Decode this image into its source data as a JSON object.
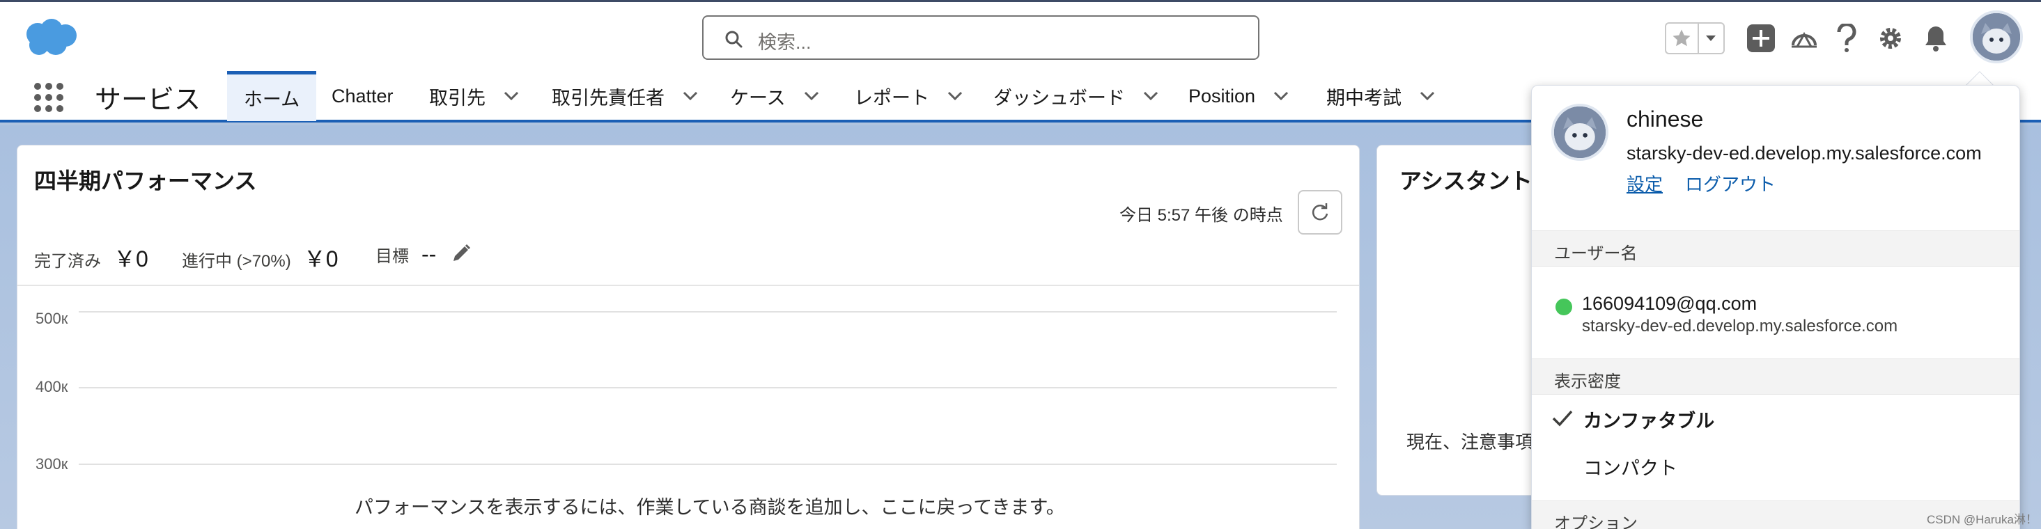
{
  "header": {
    "search_placeholder": "検索...",
    "icons": [
      "salesforce-cloud-logo",
      "search-icon",
      "star-icon",
      "chevron-down-icon",
      "plus-icon",
      "trailhead-icon",
      "help-icon",
      "gear-icon",
      "bell-icon",
      "avatar"
    ]
  },
  "nav": {
    "app_name": "サービス",
    "tabs": [
      {
        "label": "ホーム",
        "active": true
      },
      {
        "label": "Chatter"
      },
      {
        "label": "取引先"
      },
      {
        "label": "取引先責任者"
      },
      {
        "label": "ケース"
      },
      {
        "label": "レポート"
      },
      {
        "label": "ダッシュボード"
      },
      {
        "label": "Position"
      },
      {
        "label": "期中考試"
      }
    ]
  },
  "performance": {
    "title": "四半期パフォーマンス",
    "as_of": "今日 5:57 午後 の時点",
    "closed_label": "完了済み",
    "closed_value": "￥0",
    "open_label": "進行中 (>70%)",
    "open_value": "￥0",
    "goal_label": "目標",
    "goal_value": "--",
    "y_ticks": [
      "500к",
      "400к",
      "300к"
    ],
    "empty_message": "パフォーマンスを表示するには、作業している商談を追加し、ここに戻ってきます。"
  },
  "assistant": {
    "title": "アシスタント",
    "message": "現在、注意事項"
  },
  "profile_menu": {
    "display_name": "chinese",
    "org_domain": "starsky-dev-ed.develop.my.salesforce.com",
    "settings_link": "設定",
    "logout_link": "ログアウト",
    "username_section": "ユーザー名",
    "username": "166094109@qq.com",
    "username_domain": "starsky-dev-ed.develop.my.salesforce.com",
    "density_section": "表示密度",
    "density_comfy": "カンファタブル",
    "density_compact": "コンパクト",
    "options_section": "オプション"
  },
  "watermark": "CSDN @Haruka淋！",
  "colors": {
    "brand_blue": "#1b5fb5",
    "link_blue": "#0b5cab",
    "status_green": "#45c65a",
    "background": "#b0c4df"
  }
}
